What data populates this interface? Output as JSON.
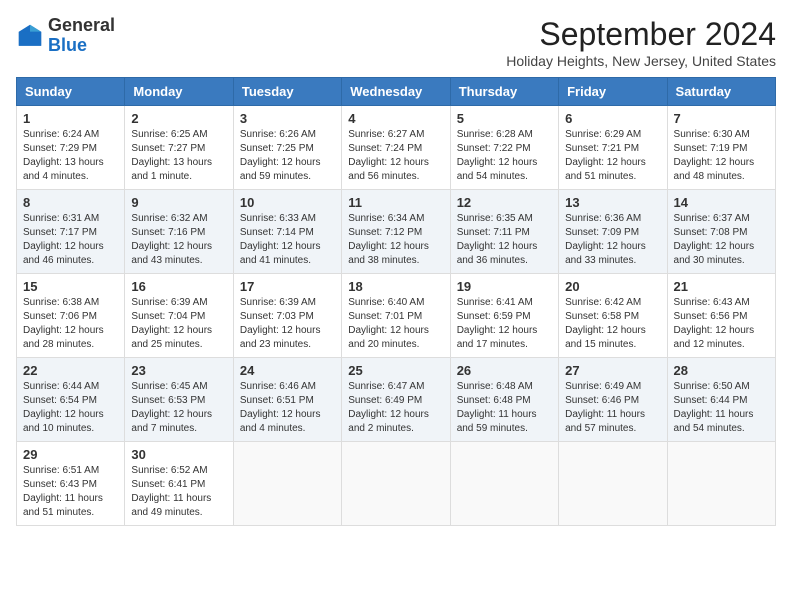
{
  "logo": {
    "line1": "General",
    "line2": "Blue"
  },
  "title": "September 2024",
  "location": "Holiday Heights, New Jersey, United States",
  "weekdays": [
    "Sunday",
    "Monday",
    "Tuesday",
    "Wednesday",
    "Thursday",
    "Friday",
    "Saturday"
  ],
  "weeks": [
    [
      {
        "day": "1",
        "info": "Sunrise: 6:24 AM\nSunset: 7:29 PM\nDaylight: 13 hours\nand 4 minutes."
      },
      {
        "day": "2",
        "info": "Sunrise: 6:25 AM\nSunset: 7:27 PM\nDaylight: 13 hours\nand 1 minute."
      },
      {
        "day": "3",
        "info": "Sunrise: 6:26 AM\nSunset: 7:25 PM\nDaylight: 12 hours\nand 59 minutes."
      },
      {
        "day": "4",
        "info": "Sunrise: 6:27 AM\nSunset: 7:24 PM\nDaylight: 12 hours\nand 56 minutes."
      },
      {
        "day": "5",
        "info": "Sunrise: 6:28 AM\nSunset: 7:22 PM\nDaylight: 12 hours\nand 54 minutes."
      },
      {
        "day": "6",
        "info": "Sunrise: 6:29 AM\nSunset: 7:21 PM\nDaylight: 12 hours\nand 51 minutes."
      },
      {
        "day": "7",
        "info": "Sunrise: 6:30 AM\nSunset: 7:19 PM\nDaylight: 12 hours\nand 48 minutes."
      }
    ],
    [
      {
        "day": "8",
        "info": "Sunrise: 6:31 AM\nSunset: 7:17 PM\nDaylight: 12 hours\nand 46 minutes."
      },
      {
        "day": "9",
        "info": "Sunrise: 6:32 AM\nSunset: 7:16 PM\nDaylight: 12 hours\nand 43 minutes."
      },
      {
        "day": "10",
        "info": "Sunrise: 6:33 AM\nSunset: 7:14 PM\nDaylight: 12 hours\nand 41 minutes."
      },
      {
        "day": "11",
        "info": "Sunrise: 6:34 AM\nSunset: 7:12 PM\nDaylight: 12 hours\nand 38 minutes."
      },
      {
        "day": "12",
        "info": "Sunrise: 6:35 AM\nSunset: 7:11 PM\nDaylight: 12 hours\nand 36 minutes."
      },
      {
        "day": "13",
        "info": "Sunrise: 6:36 AM\nSunset: 7:09 PM\nDaylight: 12 hours\nand 33 minutes."
      },
      {
        "day": "14",
        "info": "Sunrise: 6:37 AM\nSunset: 7:08 PM\nDaylight: 12 hours\nand 30 minutes."
      }
    ],
    [
      {
        "day": "15",
        "info": "Sunrise: 6:38 AM\nSunset: 7:06 PM\nDaylight: 12 hours\nand 28 minutes."
      },
      {
        "day": "16",
        "info": "Sunrise: 6:39 AM\nSunset: 7:04 PM\nDaylight: 12 hours\nand 25 minutes."
      },
      {
        "day": "17",
        "info": "Sunrise: 6:39 AM\nSunset: 7:03 PM\nDaylight: 12 hours\nand 23 minutes."
      },
      {
        "day": "18",
        "info": "Sunrise: 6:40 AM\nSunset: 7:01 PM\nDaylight: 12 hours\nand 20 minutes."
      },
      {
        "day": "19",
        "info": "Sunrise: 6:41 AM\nSunset: 6:59 PM\nDaylight: 12 hours\nand 17 minutes."
      },
      {
        "day": "20",
        "info": "Sunrise: 6:42 AM\nSunset: 6:58 PM\nDaylight: 12 hours\nand 15 minutes."
      },
      {
        "day": "21",
        "info": "Sunrise: 6:43 AM\nSunset: 6:56 PM\nDaylight: 12 hours\nand 12 minutes."
      }
    ],
    [
      {
        "day": "22",
        "info": "Sunrise: 6:44 AM\nSunset: 6:54 PM\nDaylight: 12 hours\nand 10 minutes."
      },
      {
        "day": "23",
        "info": "Sunrise: 6:45 AM\nSunset: 6:53 PM\nDaylight: 12 hours\nand 7 minutes."
      },
      {
        "day": "24",
        "info": "Sunrise: 6:46 AM\nSunset: 6:51 PM\nDaylight: 12 hours\nand 4 minutes."
      },
      {
        "day": "25",
        "info": "Sunrise: 6:47 AM\nSunset: 6:49 PM\nDaylight: 12 hours\nand 2 minutes."
      },
      {
        "day": "26",
        "info": "Sunrise: 6:48 AM\nSunset: 6:48 PM\nDaylight: 11 hours\nand 59 minutes."
      },
      {
        "day": "27",
        "info": "Sunrise: 6:49 AM\nSunset: 6:46 PM\nDaylight: 11 hours\nand 57 minutes."
      },
      {
        "day": "28",
        "info": "Sunrise: 6:50 AM\nSunset: 6:44 PM\nDaylight: 11 hours\nand 54 minutes."
      }
    ],
    [
      {
        "day": "29",
        "info": "Sunrise: 6:51 AM\nSunset: 6:43 PM\nDaylight: 11 hours\nand 51 minutes."
      },
      {
        "day": "30",
        "info": "Sunrise: 6:52 AM\nSunset: 6:41 PM\nDaylight: 11 hours\nand 49 minutes."
      },
      {
        "day": "",
        "info": ""
      },
      {
        "day": "",
        "info": ""
      },
      {
        "day": "",
        "info": ""
      },
      {
        "day": "",
        "info": ""
      },
      {
        "day": "",
        "info": ""
      }
    ]
  ]
}
